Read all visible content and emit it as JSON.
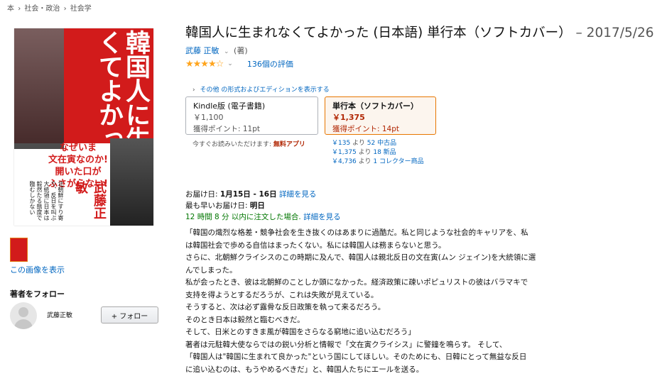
{
  "breadcrumb": [
    "本",
    "›",
    "社会・政治",
    "›",
    "社会学"
  ],
  "cover": {
    "title": "韓国人に生まれなくてよかった",
    "tagline": [
      "なぜいま",
      "文在寅なのか!",
      "開いた口が",
      "ふさがらない!"
    ],
    "author": "武藤正敏",
    "blurb": "北朝鮮にすり寄り、反日を叫ぶ大統領に日本は毅然たる態度で臨むしかない"
  },
  "thumb_link": "この画像を表示",
  "follow": {
    "title": "著者をフォロー",
    "author": "武藤正敏",
    "button": "+ フォロー"
  },
  "product": {
    "title": "韓国人に生まれなくてよかった (日本語) 単行本（ソフトカバー）",
    "date": "– 2017/5/26",
    "author": "武藤 正敏",
    "author_role": "(著)",
    "stars": "★★★★☆",
    "ratings": "136個の評価",
    "other_formats": "その他 の形式およびエディションを表示する"
  },
  "formats": {
    "kindle": {
      "name": "Kindle版 (電子書籍)",
      "price": "￥1,100",
      "points": "獲得ポイント: 11pt"
    },
    "soft": {
      "name": "単行本（ソフトカバー）",
      "price": "￥1,375",
      "points": "獲得ポイント: 14pt"
    }
  },
  "readnow": {
    "text": "今すぐお読みいただけます:",
    "app": "無料アプリ"
  },
  "offers": [
    {
      "price": "￥135",
      "from": "より",
      "count": "52",
      "cond": "中古品"
    },
    {
      "price": "￥1,375",
      "from": "より",
      "count": "18",
      "cond": "新品"
    },
    {
      "price": "￥4,736",
      "from": "より",
      "count": "1",
      "cond": "コレクター商品"
    }
  ],
  "delivery": {
    "label": "お届け日:",
    "dates": "1月15日 - 16日",
    "details": "詳細を見る",
    "fastest_label": "最も早いお届け日:",
    "fastest": "明日",
    "cutoff": "12 時間 8 分 以内に注文した場合.",
    "cutoff_details": "詳細を見る"
  },
  "description": [
    "「韓国の熾烈な格差・競争社会を生き抜くのはあまりに過酷だ。私と同じような社会的キャリアを、私",
    "は韓国社会で歩める自信はまったくない。私には韓国人は務まらないと思う。",
    "さらに、北朝鮮クライシスのこの時期に及んで、韓国人は親北反日の文在寅(ムン ジェイン)を大統領に選",
    "んでしまった。",
    "私が会ったとき、彼は北朝鮮のことしか頭になかった。経済政策に疎いポピュリストの彼はバラマキで",
    "支持を得ようとするだろうが、これは失敗が見えている。",
    "そうすると、次は必ず露骨な反日政策を執って来るだろう。",
    "そのとき日本は毅然と臨むべきだ。",
    "そして、日米とのすきま風が韓国をさらなる窮地に追い込むだろう」",
    "著者は元駐韓大使ならではの鋭い分析と情報で「文在寅クライシス」に警鐘を鳴らす。 そして、",
    "「韓国人は\"韓国に生まれて良かった\"という国にしてほしい。そのためにも、日韓にとって無益な反日",
    "に追い込むのは、もうやめるべきだ」と、韓国人たちにエールを送る。"
  ]
}
